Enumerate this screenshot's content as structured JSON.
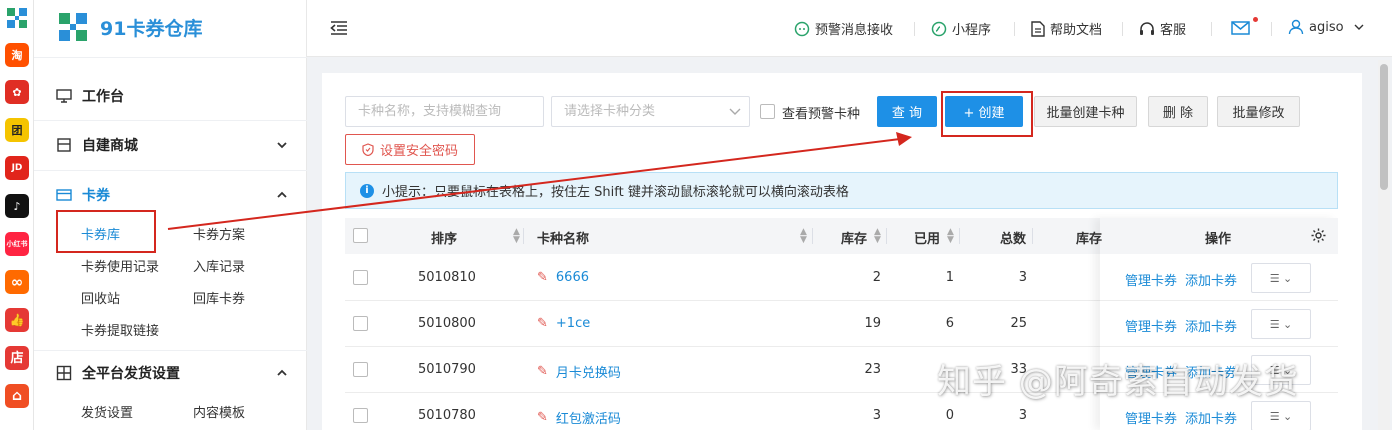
{
  "app_strip": {
    "items": [
      {
        "name": "app-logo",
        "label": "",
        "color": "#2aa36b"
      },
      {
        "name": "taobao",
        "label": "淘",
        "color": "#ff5000"
      },
      {
        "name": "pinduoduo",
        "label": "✿",
        "color": "#e02e24"
      },
      {
        "name": "app-yellow",
        "label": "团",
        "color": "#f5c400"
      },
      {
        "name": "jd",
        "label": "JD",
        "color": "#e1251b"
      },
      {
        "name": "tiktok",
        "label": "♪",
        "color": "#111111"
      },
      {
        "name": "xiaohongshu",
        "label": "小红书",
        "color": "#ff2442"
      },
      {
        "name": "app-orange",
        "label": "∞",
        "color": "#ff6a00"
      },
      {
        "name": "app-thumb",
        "label": "👍",
        "color": "#e53935"
      },
      {
        "name": "dian",
        "label": "店",
        "color": "#e53935"
      },
      {
        "name": "app-bag",
        "label": "⌂",
        "color": "#f04e23"
      }
    ]
  },
  "sidebar": {
    "logo_text": "91卡券仓库",
    "groups": [
      {
        "label": "工作台"
      },
      {
        "label": "自建商城"
      },
      {
        "label": "卡券"
      },
      {
        "label": "全平台发货设置"
      }
    ],
    "sub_items": {
      "kaquan_ku": "卡券库",
      "kaquan_fangan": "卡券方案",
      "shiyong_jilu": "卡券使用记录",
      "ruku_jilu": "入库记录",
      "huishouzhan": "回收站",
      "huiku_kaquan": "回库卡券",
      "tiqu_lianjie": "卡券提取链接",
      "fahuo_shezhi": "发货设置",
      "neirong_muban": "内容模板"
    }
  },
  "header": {
    "alert": "预警消息接收",
    "miniapp": "小程序",
    "help": "帮助文档",
    "service": "客服",
    "user": "agiso"
  },
  "toolbar": {
    "name_placeholder": "卡种名称，支持模糊查询",
    "category_placeholder": "请选择卡种分类",
    "warning_label": "查看预警卡种",
    "query": "查 询",
    "create": "+ 创建",
    "batch_create": "批量创建卡种",
    "delete": "删 除",
    "batch_edit": "批量修改",
    "security_pwd": "设置安全密码"
  },
  "tip": "小提示：只要鼠标在表格上，按住左 Shift 键并滚动鼠标滚轮就可以横向滚动表格",
  "table": {
    "headers": {
      "sort": "排序",
      "name": "卡种名称",
      "stock": "库存",
      "used": "已用",
      "total": "总数",
      "extra": "库存",
      "ops": "操作"
    },
    "rows": [
      {
        "sort": "5010810",
        "name": "6666",
        "stock": "2",
        "used": "1",
        "total": "3"
      },
      {
        "sort": "5010800",
        "name": "+1ce",
        "stock": "19",
        "used": "6",
        "total": "25"
      },
      {
        "sort": "5010790",
        "name": "月卡兑换码",
        "stock": "23",
        "used": "",
        "total": "33"
      },
      {
        "sort": "5010780",
        "name": "红包激活码",
        "stock": "3",
        "used": "0",
        "total": "3"
      }
    ],
    "op_manage": "管理卡券",
    "op_add": "添加卡券",
    "op_more": "☰ ⌄"
  },
  "watermark": "知乎 @阿奇索自动发货",
  "colors": {
    "primary": "#1e90e6",
    "annotation": "#d4271e",
    "danger": "#e0564f"
  }
}
